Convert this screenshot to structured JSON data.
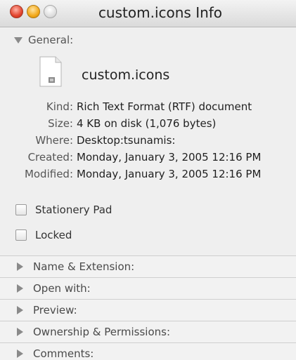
{
  "window": {
    "title": "custom.icons Info"
  },
  "general": {
    "header": "General:",
    "file_name": "custom.icons",
    "rows": [
      {
        "key": "Kind:",
        "value": "Rich Text Format (RTF) document"
      },
      {
        "key": "Size:",
        "value": "4 KB on disk (1,076 bytes)"
      },
      {
        "key": "Where:",
        "value": "Desktop:tsunamis:"
      },
      {
        "key": "Created:",
        "value": "Monday, January 3, 2005 12:16 PM"
      },
      {
        "key": "Modified:",
        "value": "Monday, January 3, 2005 12:16 PM"
      }
    ],
    "stationery_label": "Stationery Pad",
    "locked_label": "Locked"
  },
  "sections": [
    {
      "label": "Name & Extension:"
    },
    {
      "label": "Open with:"
    },
    {
      "label": "Preview:"
    },
    {
      "label": "Ownership & Permissions:"
    },
    {
      "label": "Comments:"
    }
  ],
  "icons": {
    "close": "close-button",
    "minimize": "minimize-button",
    "zoom": "zoom-button",
    "file": "rtf-document-icon"
  }
}
